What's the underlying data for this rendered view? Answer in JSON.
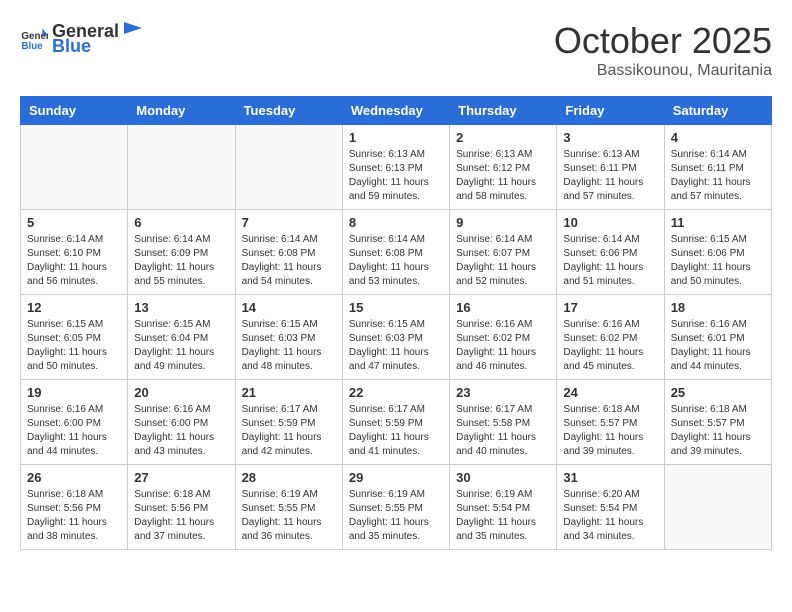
{
  "header": {
    "logo_general": "General",
    "logo_blue": "Blue",
    "month": "October 2025",
    "location": "Bassikounou, Mauritania"
  },
  "weekdays": [
    "Sunday",
    "Monday",
    "Tuesday",
    "Wednesday",
    "Thursday",
    "Friday",
    "Saturday"
  ],
  "weeks": [
    [
      {
        "day": "",
        "info": ""
      },
      {
        "day": "",
        "info": ""
      },
      {
        "day": "",
        "info": ""
      },
      {
        "day": "1",
        "info": "Sunrise: 6:13 AM\nSunset: 6:13 PM\nDaylight: 11 hours\nand 59 minutes."
      },
      {
        "day": "2",
        "info": "Sunrise: 6:13 AM\nSunset: 6:12 PM\nDaylight: 11 hours\nand 58 minutes."
      },
      {
        "day": "3",
        "info": "Sunrise: 6:13 AM\nSunset: 6:11 PM\nDaylight: 11 hours\nand 57 minutes."
      },
      {
        "day": "4",
        "info": "Sunrise: 6:14 AM\nSunset: 6:11 PM\nDaylight: 11 hours\nand 57 minutes."
      }
    ],
    [
      {
        "day": "5",
        "info": "Sunrise: 6:14 AM\nSunset: 6:10 PM\nDaylight: 11 hours\nand 56 minutes."
      },
      {
        "day": "6",
        "info": "Sunrise: 6:14 AM\nSunset: 6:09 PM\nDaylight: 11 hours\nand 55 minutes."
      },
      {
        "day": "7",
        "info": "Sunrise: 6:14 AM\nSunset: 6:08 PM\nDaylight: 11 hours\nand 54 minutes."
      },
      {
        "day": "8",
        "info": "Sunrise: 6:14 AM\nSunset: 6:08 PM\nDaylight: 11 hours\nand 53 minutes."
      },
      {
        "day": "9",
        "info": "Sunrise: 6:14 AM\nSunset: 6:07 PM\nDaylight: 11 hours\nand 52 minutes."
      },
      {
        "day": "10",
        "info": "Sunrise: 6:14 AM\nSunset: 6:06 PM\nDaylight: 11 hours\nand 51 minutes."
      },
      {
        "day": "11",
        "info": "Sunrise: 6:15 AM\nSunset: 6:06 PM\nDaylight: 11 hours\nand 50 minutes."
      }
    ],
    [
      {
        "day": "12",
        "info": "Sunrise: 6:15 AM\nSunset: 6:05 PM\nDaylight: 11 hours\nand 50 minutes."
      },
      {
        "day": "13",
        "info": "Sunrise: 6:15 AM\nSunset: 6:04 PM\nDaylight: 11 hours\nand 49 minutes."
      },
      {
        "day": "14",
        "info": "Sunrise: 6:15 AM\nSunset: 6:03 PM\nDaylight: 11 hours\nand 48 minutes."
      },
      {
        "day": "15",
        "info": "Sunrise: 6:15 AM\nSunset: 6:03 PM\nDaylight: 11 hours\nand 47 minutes."
      },
      {
        "day": "16",
        "info": "Sunrise: 6:16 AM\nSunset: 6:02 PM\nDaylight: 11 hours\nand 46 minutes."
      },
      {
        "day": "17",
        "info": "Sunrise: 6:16 AM\nSunset: 6:02 PM\nDaylight: 11 hours\nand 45 minutes."
      },
      {
        "day": "18",
        "info": "Sunrise: 6:16 AM\nSunset: 6:01 PM\nDaylight: 11 hours\nand 44 minutes."
      }
    ],
    [
      {
        "day": "19",
        "info": "Sunrise: 6:16 AM\nSunset: 6:00 PM\nDaylight: 11 hours\nand 44 minutes."
      },
      {
        "day": "20",
        "info": "Sunrise: 6:16 AM\nSunset: 6:00 PM\nDaylight: 11 hours\nand 43 minutes."
      },
      {
        "day": "21",
        "info": "Sunrise: 6:17 AM\nSunset: 5:59 PM\nDaylight: 11 hours\nand 42 minutes."
      },
      {
        "day": "22",
        "info": "Sunrise: 6:17 AM\nSunset: 5:59 PM\nDaylight: 11 hours\nand 41 minutes."
      },
      {
        "day": "23",
        "info": "Sunrise: 6:17 AM\nSunset: 5:58 PM\nDaylight: 11 hours\nand 40 minutes."
      },
      {
        "day": "24",
        "info": "Sunrise: 6:18 AM\nSunset: 5:57 PM\nDaylight: 11 hours\nand 39 minutes."
      },
      {
        "day": "25",
        "info": "Sunrise: 6:18 AM\nSunset: 5:57 PM\nDaylight: 11 hours\nand 39 minutes."
      }
    ],
    [
      {
        "day": "26",
        "info": "Sunrise: 6:18 AM\nSunset: 5:56 PM\nDaylight: 11 hours\nand 38 minutes."
      },
      {
        "day": "27",
        "info": "Sunrise: 6:18 AM\nSunset: 5:56 PM\nDaylight: 11 hours\nand 37 minutes."
      },
      {
        "day": "28",
        "info": "Sunrise: 6:19 AM\nSunset: 5:55 PM\nDaylight: 11 hours\nand 36 minutes."
      },
      {
        "day": "29",
        "info": "Sunrise: 6:19 AM\nSunset: 5:55 PM\nDaylight: 11 hours\nand 35 minutes."
      },
      {
        "day": "30",
        "info": "Sunrise: 6:19 AM\nSunset: 5:54 PM\nDaylight: 11 hours\nand 35 minutes."
      },
      {
        "day": "31",
        "info": "Sunrise: 6:20 AM\nSunset: 5:54 PM\nDaylight: 11 hours\nand 34 minutes."
      },
      {
        "day": "",
        "info": ""
      }
    ]
  ]
}
